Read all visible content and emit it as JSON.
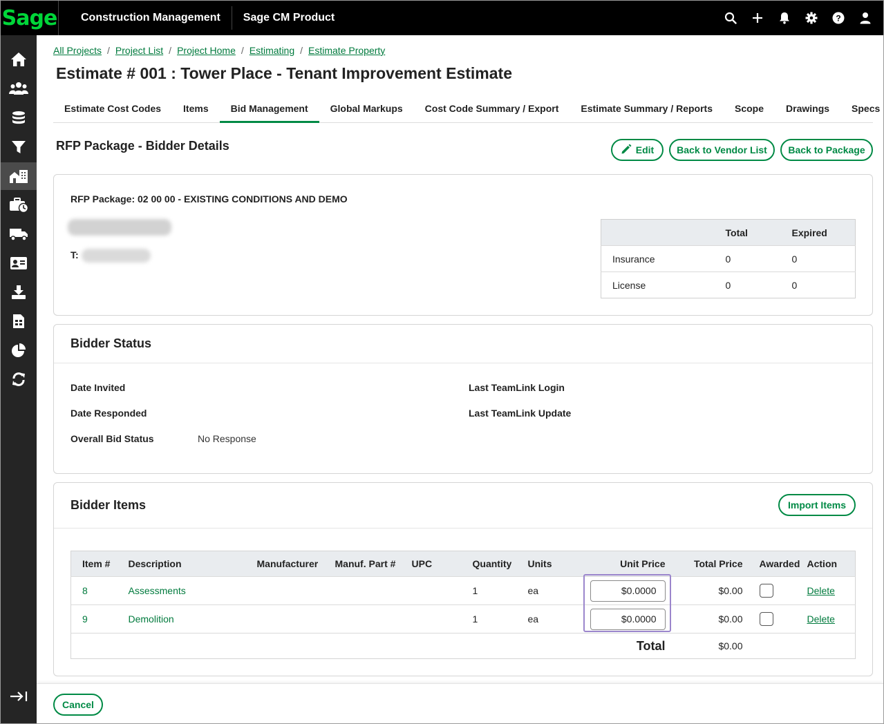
{
  "app": {
    "logo": "Sage",
    "product": "Construction Management",
    "subproduct": "Sage CM Product"
  },
  "topicons": [
    "search-icon",
    "plus-icon",
    "bell-icon",
    "gear-icon",
    "help-icon",
    "user-icon"
  ],
  "sidebar": [
    "home-icon",
    "users-icon",
    "database-icon",
    "filter-icon",
    "projects-icon",
    "briefcase-clock-icon",
    "truck-icon",
    "contact-card-icon",
    "download-icon",
    "spreadsheet-icon",
    "pie-chart-icon",
    "sync-icon",
    "collapse-icon"
  ],
  "breadcrumbs": [
    "All Projects",
    "Project List",
    "Project Home",
    "Estimating",
    "Estimate Property"
  ],
  "page_title": "Estimate # 001 : Tower Place - Tenant Improvement Estimate",
  "tabs": [
    "Estimate Cost Codes",
    "Items",
    "Bid Management",
    "Global Markups",
    "Cost Code Summary / Export",
    "Estimate Summary / Reports",
    "Scope",
    "Drawings",
    "Specs"
  ],
  "active_tab": "Bid Management",
  "section": {
    "title": "RFP Package - Bidder Details",
    "edit_label": "Edit",
    "back_vendor_label": "Back to Vendor List",
    "back_package_label": "Back to Package"
  },
  "details": {
    "package_label": "RFP Package: 02 00 00 - EXISTING CONDITIONS AND DEMO",
    "phone_label": "T:",
    "compliance": {
      "headers": [
        "",
        "Total",
        "Expired"
      ],
      "rows": [
        {
          "name": "Insurance",
          "total": "0",
          "expired": "0"
        },
        {
          "name": "License",
          "total": "0",
          "expired": "0"
        }
      ]
    }
  },
  "status": {
    "title": "Bidder Status",
    "date_invited": "Date Invited",
    "date_responded": "Date Responded",
    "overall_label": "Overall Bid Status",
    "overall_value": "No Response",
    "last_login": "Last TeamLink Login",
    "last_update": "Last TeamLink Update"
  },
  "items": {
    "title": "Bidder Items",
    "import_label": "Import Items",
    "headers": [
      "Item #",
      "Description",
      "Manufacturer",
      "Manuf. Part #",
      "UPC",
      "Quantity",
      "Units",
      "Unit Price",
      "Total Price",
      "Awarded",
      "Action"
    ],
    "rows": [
      {
        "num": "8",
        "desc": "Assessments",
        "qty": "1",
        "units": "ea",
        "unit_price": "$0.0000",
        "total": "$0.00",
        "action": "Delete"
      },
      {
        "num": "9",
        "desc": "Demolition",
        "qty": "1",
        "units": "ea",
        "unit_price": "$0.0000",
        "total": "$0.00",
        "action": "Delete"
      }
    ],
    "total_label": "Total",
    "total_value": "$0.00"
  },
  "footer": {
    "cancel_label": "Cancel"
  },
  "colors": {
    "brand_green": "#008a45",
    "logo_green": "#00d639",
    "sidebar_bg": "#252525",
    "topbar_bg": "#000000"
  }
}
